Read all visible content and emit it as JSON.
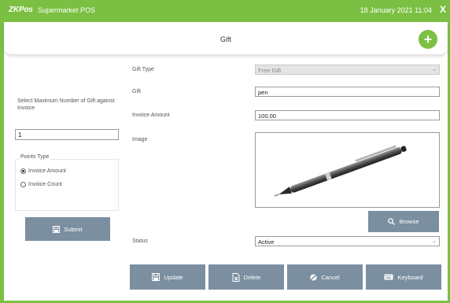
{
  "titlebar": {
    "logo": "ZKPos",
    "app_name": "Supermarket POS",
    "datetime": "18 January 2021 11:04",
    "close": "X"
  },
  "header": {
    "title": "Gift",
    "add_button": "+"
  },
  "left_panel": {
    "max_gift_label": "Select Maximum Number of Gift against Invoice",
    "max_gift_value": "1",
    "points_type_label": "Points Type",
    "radio_options": [
      {
        "label": "Invoice Amount",
        "selected": true
      },
      {
        "label": "Invoice Count",
        "selected": false
      }
    ],
    "submit_label": "Submit"
  },
  "form": {
    "gift_type_label": "Gift Type",
    "gift_type_value": "Free Gift",
    "gift_label": "Gift",
    "gift_value": "pen",
    "invoice_amount_label": "Invoice Amount",
    "invoice_amount_value": "100.00",
    "image_label": "Image",
    "browse_label": "Browse",
    "status_label": "Status",
    "status_value": "Active"
  },
  "actions": {
    "update": "Update",
    "delete": "Delete",
    "cancel": "Cancel",
    "keyboard": "Keyboard"
  },
  "colors": {
    "brand_green": "#7bc043",
    "button_gray": "#7b8fa0"
  },
  "icons": [
    "close-icon",
    "plus-icon",
    "save-icon",
    "search-icon",
    "delete-file-icon",
    "cancel-icon",
    "keyboard-icon",
    "pen-image"
  ]
}
